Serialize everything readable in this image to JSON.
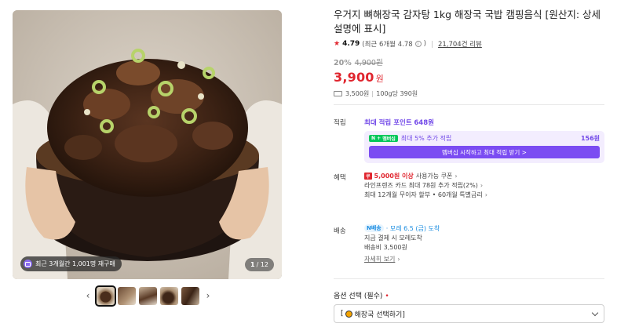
{
  "gallery": {
    "badge_text": "최근 3개월간 1,001명 재구매",
    "counter_current": "1",
    "counter_total": "/ 12",
    "prev_arrow": "‹",
    "next_arrow": "›"
  },
  "product": {
    "title": "우거지 뼈해장국 감자탕 1kg 해장국 국밥 캠핑음식 [원산지: 상세설명에 표시]",
    "rating_star": "★",
    "rating_score": "4.79",
    "rating_recent": "(최근 6개월 4.78",
    "rating_recent_close": ")",
    "review_count": "21,704건 리뷰",
    "discount_pct": "20%",
    "original_price": "4,900원",
    "sale_price": "3,900",
    "sale_unit": "원",
    "shipping_fee_short": "3,500원",
    "unit_price": "100g당 390원"
  },
  "points": {
    "label": "적립",
    "head_prefix": "최대 적립 포인트",
    "head_value": "648원",
    "npay": "N +",
    "npay_sub": "멤버십",
    "extra_text": "최대 5% 추가 적립",
    "extra_value": "156원",
    "button": "멤버십 시작하고 최대 적립 받기 >"
  },
  "benefits": {
    "label": "혜택",
    "coupon_tag": "쿠",
    "coupon_red": "5,000원 이상",
    "coupon_rest": "사용가능 쿠폰",
    "card_line": "라인프렌즈 카드 최대 78원 추가 적립(2%)",
    "installment_line": "최대 12개월 무이자 할부 • 60개월 특별금리"
  },
  "shipping": {
    "label": "배송",
    "badge": "N배송",
    "arrival": "· 모레 6.5 (금) 도착",
    "pay_line": "지금 결제 시 모레도착",
    "fee_line": "배송비 3,500원",
    "detail_link": "자세히 보기"
  },
  "option": {
    "label": "옵션 선택 (필수)",
    "required_mark": "•",
    "select_value": "해장국 선택하기]",
    "select_prefix": "["
  },
  "colors": {
    "accent_red": "#e0262f",
    "accent_purple": "#7148e8",
    "npay_green": "#03c75a",
    "ship_blue": "#1a8ce0"
  }
}
